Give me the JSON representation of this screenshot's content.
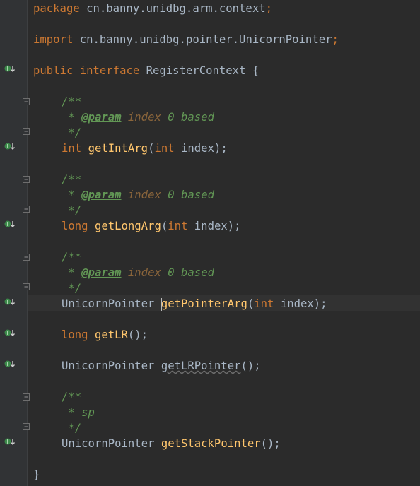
{
  "code": {
    "package_kw": "package",
    "package_name": " cn.banny.unidbg.arm.context",
    "import_kw": "import",
    "import_name": " cn.banny.unidbg.pointer.UnicornPointer",
    "semicolon": ";",
    "public_kw": "public",
    "interface_kw": "interface",
    "interface_name": " RegisterContext {",
    "closing_brace": "}",
    "doc_open": "/**",
    "doc_close": " */",
    "doc_star": " * ",
    "param_tag": "@param",
    "param_name": "index",
    "param_desc": " 0 based",
    "sp_comment": "sp",
    "int_kw": "int",
    "long_kw": "long",
    "unicorn_type": "UnicornPointer",
    "getIntArg": "getIntArg",
    "getLongArg": "getLongArg",
    "getPointerArg": "getPointerArg",
    "getLR": "getLR",
    "getLRPointer": "getLRPointer",
    "getStackPointer": "getStackPointer",
    "param_list_open": "(",
    "param_index": " index",
    "param_list_close": ");",
    "empty_params": "();"
  },
  "colors": {
    "background": "#2b2b2b",
    "keyword": "#cc7832",
    "comment": "#629755",
    "method": "#ffc66d",
    "text": "#a9b7c6",
    "implemented_marker": "#3c8a4a"
  },
  "icons": {
    "gutter_marker": "implemented-method-icon",
    "fold_marker": "fold-toggle-icon"
  }
}
